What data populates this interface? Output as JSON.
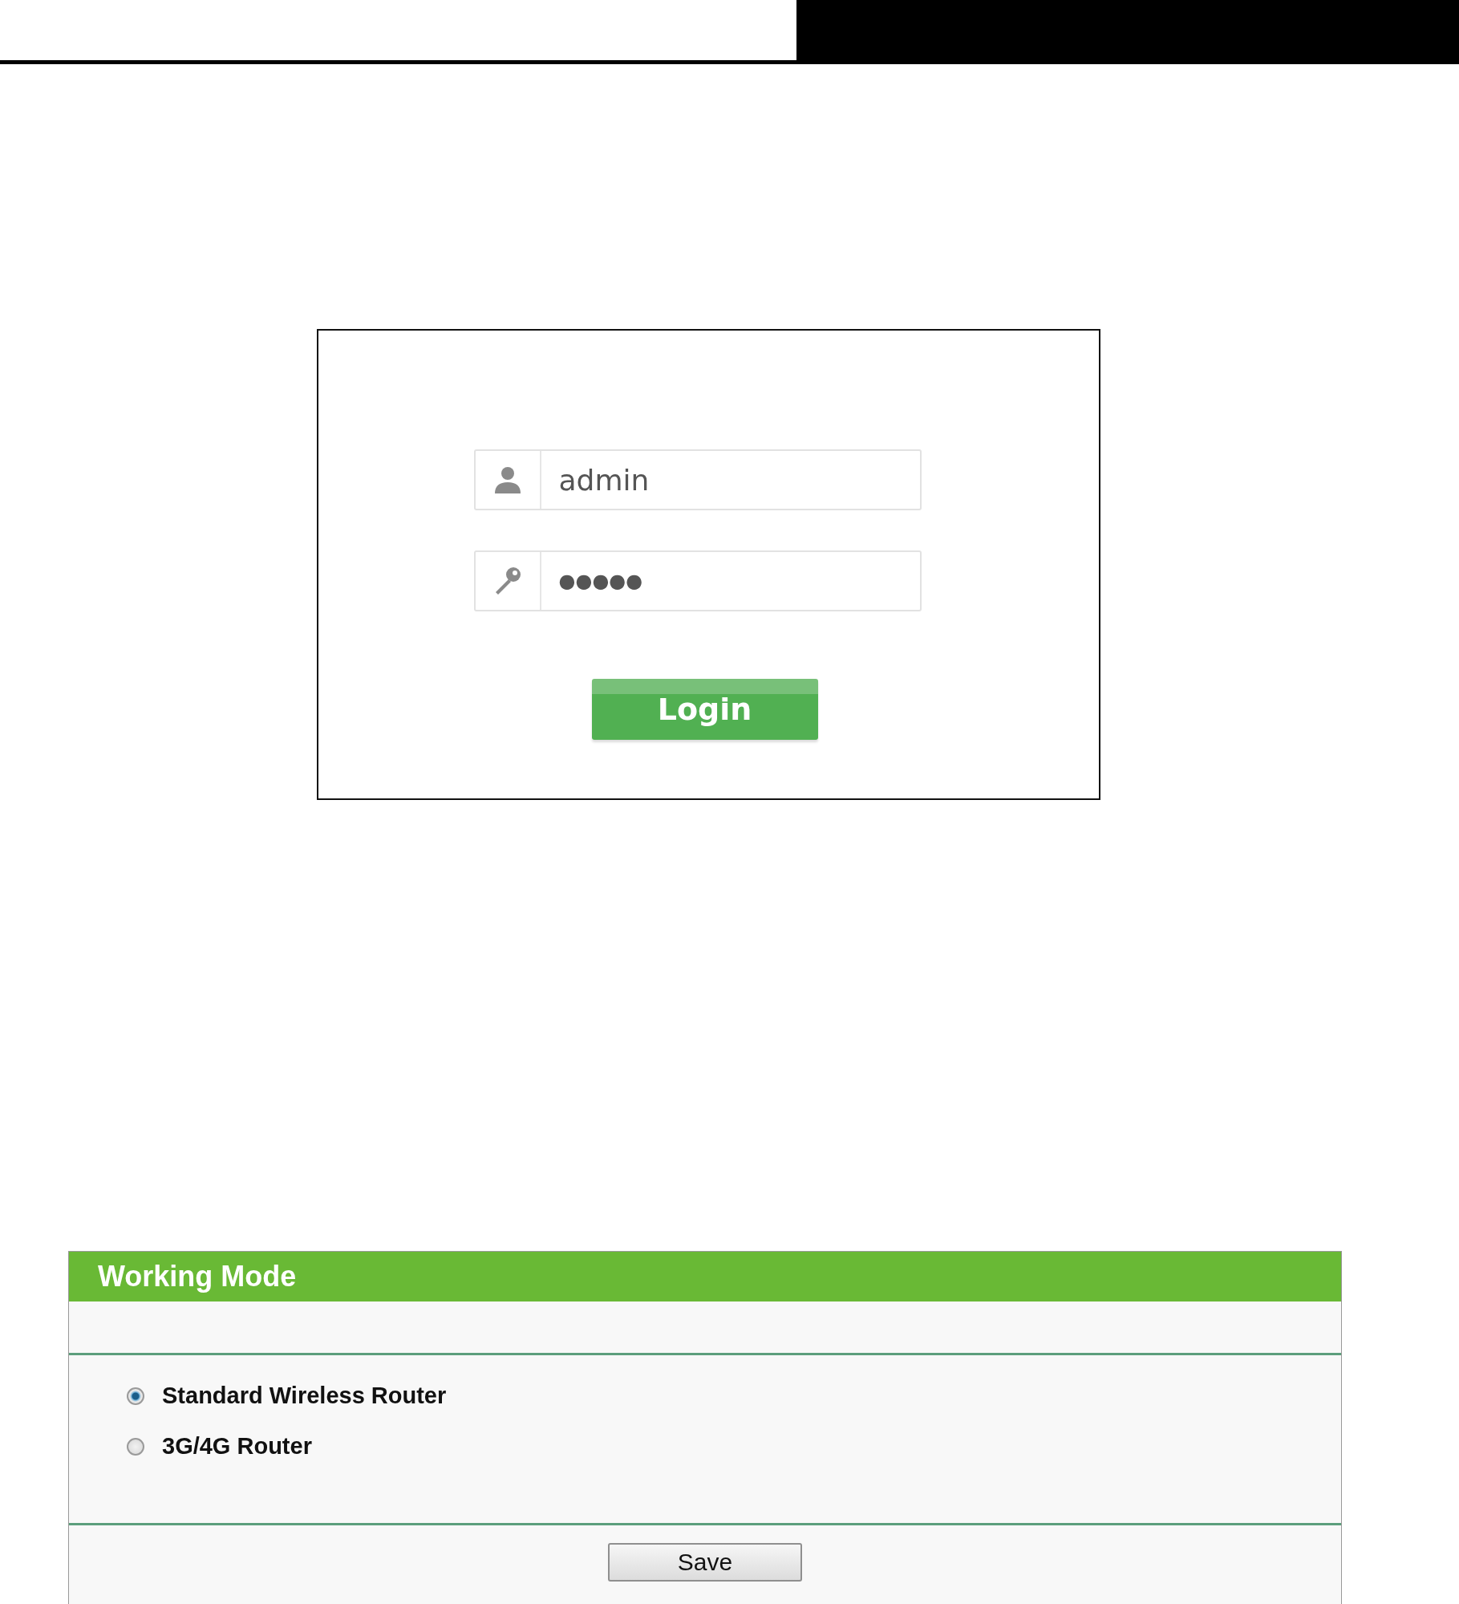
{
  "login": {
    "username": {
      "value": "admin"
    },
    "password": {
      "value": "●●●●●"
    },
    "button": "Login"
  },
  "working_mode": {
    "title": "Working Mode",
    "options": [
      {
        "label": "Standard Wireless Router",
        "selected": true
      },
      {
        "label": "3G/4G Router",
        "selected": false
      }
    ],
    "button": "Save"
  }
}
